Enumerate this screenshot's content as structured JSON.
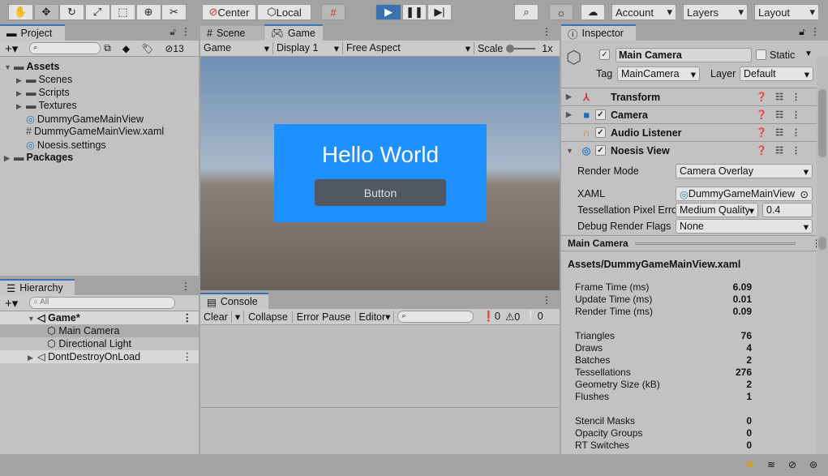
{
  "toolbar": {
    "tools": [
      "hand",
      "move",
      "rotate",
      "scale",
      "rect",
      "transform",
      "custom"
    ],
    "center": "Center",
    "local": "Local",
    "account": "Account",
    "layers": "Layers",
    "layout": "Layout"
  },
  "project": {
    "tab": "Project",
    "hidden_count": "13",
    "tree": [
      {
        "label": "Assets",
        "depth": 0,
        "bold": true,
        "open": true,
        "icon": "folder-icon"
      },
      {
        "label": "Scenes",
        "depth": 1,
        "icon": "folder-icon"
      },
      {
        "label": "Scripts",
        "depth": 1,
        "icon": "folder-icon"
      },
      {
        "label": "Textures",
        "depth": 1,
        "icon": "folder-icon"
      },
      {
        "label": "DummyGameMainView",
        "depth": 1,
        "icon": "noesis-icon"
      },
      {
        "label": "DummyGameMainView.xaml",
        "depth": 1,
        "icon": "hash-icon"
      },
      {
        "label": "Noesis.settings",
        "depth": 1,
        "icon": "noesis-icon"
      },
      {
        "label": "Packages",
        "depth": 0,
        "bold": true,
        "icon": "folder-icon"
      }
    ]
  },
  "hierarchy": {
    "tab": "Hierarchy",
    "search_placeholder": "All",
    "items": [
      {
        "label": "Game*",
        "scene": true,
        "open": true
      },
      {
        "label": "Main Camera",
        "child": true,
        "selected": true
      },
      {
        "label": "Directional Light",
        "child": true
      },
      {
        "label": "DontDestroyOnLoad",
        "scene": true
      }
    ]
  },
  "game": {
    "tabs": [
      "Scene",
      "Game"
    ],
    "mode": "Game",
    "display": "Display 1",
    "aspect": "Free Aspect",
    "scale_label": "Scale",
    "scale_value": "1x",
    "hello": "Hello World",
    "button": "Button",
    "accent": "#1e90ff"
  },
  "console": {
    "tab": "Console",
    "clear": "Clear",
    "collapse": "Collapse",
    "error_pause": "Error Pause",
    "editor": "Editor",
    "errors": "0",
    "warnings": "0",
    "logs": "0"
  },
  "inspector": {
    "tab": "Inspector",
    "name": "Main Camera",
    "static": "Static",
    "tag_label": "Tag",
    "tag": "MainCamera",
    "layer_label": "Layer",
    "layer": "Default",
    "components": [
      "Transform",
      "Camera",
      "Audio Listener",
      "Noesis View"
    ],
    "props": [
      {
        "label": "Render Mode",
        "value": "Camera Overlay"
      },
      {
        "label": "XAML",
        "value": "DummyGameMainView"
      },
      {
        "label": "Tessellation Pixel Error",
        "value": "Medium Quality",
        "extra": "0.4"
      },
      {
        "label": "Debug Render Flags",
        "value": "None"
      }
    ],
    "preview_title": "Main Camera",
    "asset_path": "Assets/DummyGameMainView.xaml",
    "stats": [
      {
        "label": "Frame Time (ms)",
        "value": "6.09"
      },
      {
        "label": "Update Time (ms)",
        "value": "0.01"
      },
      {
        "label": "Render Time (ms)",
        "value": "0.09"
      },
      {
        "label": "Triangles",
        "value": "76",
        "gap": true
      },
      {
        "label": "Draws",
        "value": "4"
      },
      {
        "label": "Batches",
        "value": "2"
      },
      {
        "label": "Tessellations",
        "value": "276"
      },
      {
        "label": "Geometry Size (kB)",
        "value": "2"
      },
      {
        "label": "Flushes",
        "value": "1"
      },
      {
        "label": "Stencil Masks",
        "value": "0",
        "gap": true
      },
      {
        "label": "Opacity Groups",
        "value": "0"
      },
      {
        "label": "RT Switches",
        "value": "0"
      }
    ]
  }
}
